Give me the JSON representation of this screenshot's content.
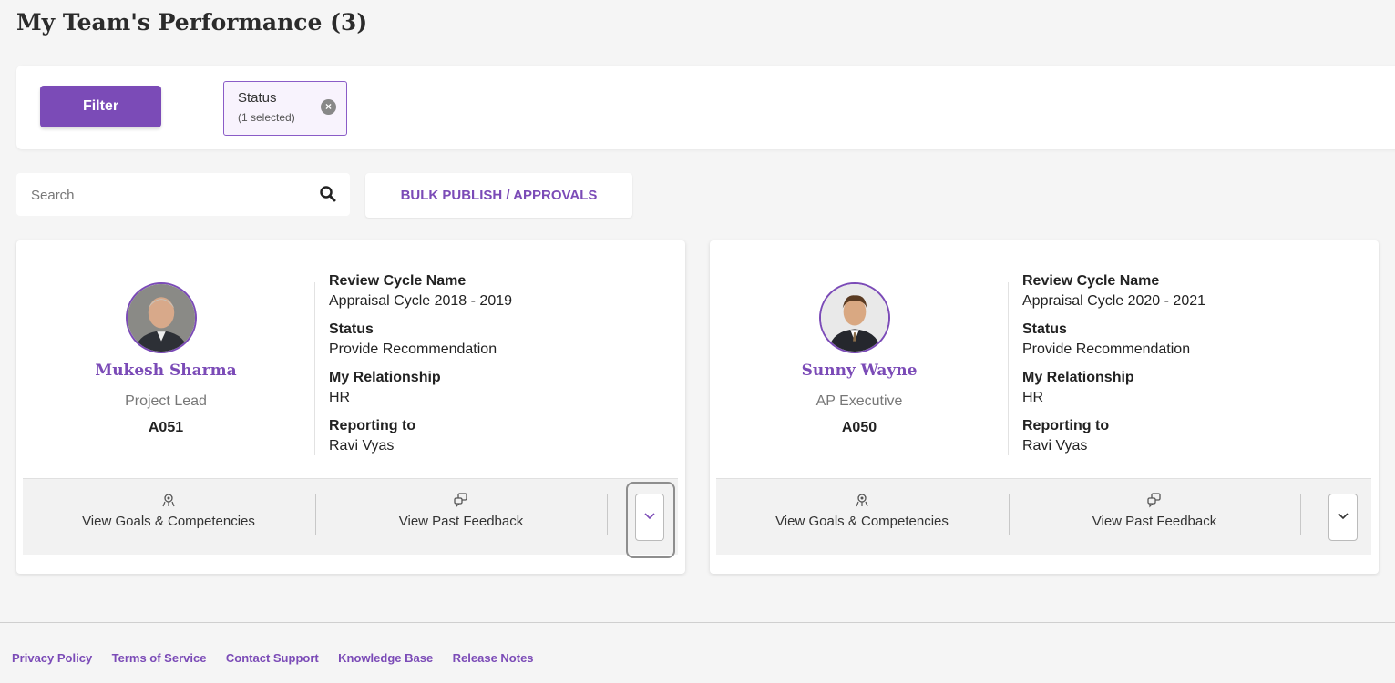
{
  "page": {
    "title": "My Team's Performance (3)"
  },
  "filters": {
    "filter_label": "Filter",
    "chip": {
      "title": "Status",
      "subtitle": "(1 selected)"
    }
  },
  "search": {
    "placeholder": "Search",
    "value": ""
  },
  "bulk_action": {
    "label": "BULK PUBLISH / APPROVALS"
  },
  "cards": [
    {
      "name": "Mukesh Sharma",
      "role": "Project Lead",
      "id": "A051",
      "fields": [
        {
          "label": "Review Cycle Name",
          "value": "Appraisal Cycle 2018 - 2019"
        },
        {
          "label": "Status",
          "value": "Provide Recommendation"
        },
        {
          "label": "My Relationship",
          "value": "HR"
        },
        {
          "label": "Reporting to",
          "value": "Ravi Vyas"
        }
      ],
      "actions": {
        "goals": "View Goals & Competencies",
        "feedback": "View Past Feedback"
      }
    },
    {
      "name": "Sunny Wayne",
      "role": "AP Executive",
      "id": "A050",
      "fields": [
        {
          "label": "Review Cycle Name",
          "value": "Appraisal Cycle 2020 - 2021"
        },
        {
          "label": "Status",
          "value": "Provide Recommendation"
        },
        {
          "label": "My Relationship",
          "value": "HR"
        },
        {
          "label": "Reporting to",
          "value": "Ravi Vyas"
        }
      ],
      "actions": {
        "goals": "View Goals & Competencies",
        "feedback": "View Past Feedback"
      }
    }
  ],
  "footer": {
    "links": [
      "Privacy Policy",
      "Terms of Service",
      "Contact Support",
      "Knowledge Base",
      "Release Notes"
    ]
  },
  "colors": {
    "accent": "#7b4bb7",
    "background": "#f5f5f5"
  },
  "icons": {
    "search": "search-icon",
    "close": "close-icon",
    "goals": "goals-icon",
    "feedback": "feedback-icon",
    "expand": "chevron-down-icon"
  }
}
